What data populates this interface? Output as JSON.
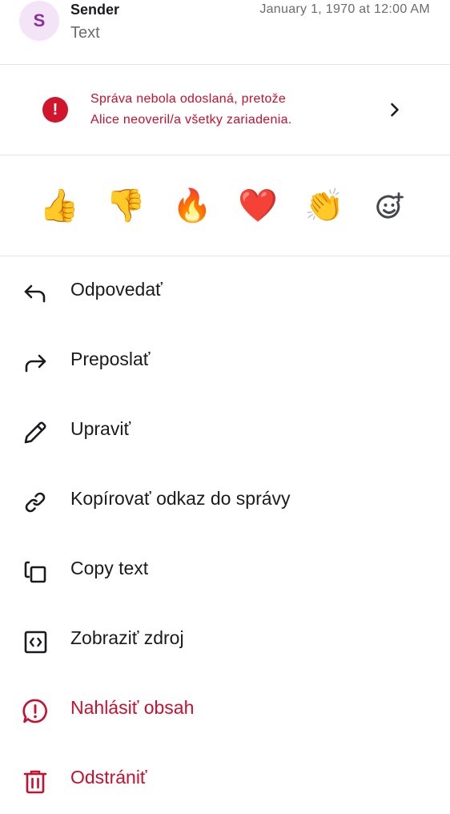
{
  "header": {
    "avatar_initial": "S",
    "sender": "Sender",
    "preview_text": "Text",
    "timestamp": "January 1, 1970 at 12:00 AM"
  },
  "error": {
    "icon": "error-circle-icon",
    "line1": "Správa nebola odoslaná, pretože",
    "line2": "Alice neoveril/a všetky zariadenia.",
    "color": "#c8102e"
  },
  "reactions": [
    {
      "emoji": "👍",
      "name": "thumbs-up"
    },
    {
      "emoji": "👎",
      "name": "thumbs-down"
    },
    {
      "emoji": "🔥",
      "name": "fire"
    },
    {
      "emoji": "❤️",
      "name": "heart"
    },
    {
      "emoji": "👏",
      "name": "clap"
    }
  ],
  "add_reaction_icon": "add-reaction-icon",
  "menu": {
    "reply": "Odpovedať",
    "forward": "Preposlať",
    "edit": "Upraviť",
    "copy_link": "Kopírovať odkaz do správy",
    "copy_text": "Copy text",
    "view_source": "Zobraziť zdroj",
    "report": "Nahlásiť obsah",
    "delete": "Odstrániť"
  },
  "colors": {
    "danger": "#c8102e",
    "avatar_bg": "#f3e4f7",
    "avatar_fg": "#8b2fa0"
  }
}
